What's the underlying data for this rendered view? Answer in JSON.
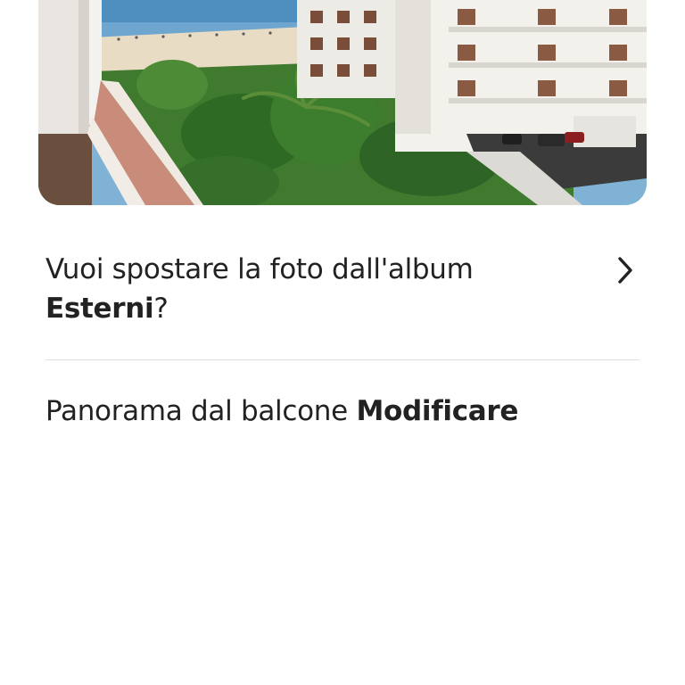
{
  "photo": {
    "image": "balcony-sea-view-photo"
  },
  "move_album": {
    "prompt_text": "Vuoi spostare la foto dall'album",
    "album_name": "Esterni",
    "question_mark": "?",
    "chevron_icon": "chevron-right-icon"
  },
  "caption": {
    "title": "Panorama dal balcone",
    "edit_label": "Modificare"
  },
  "colors": {
    "text": "#222222",
    "divider": "#dddddd",
    "background": "#ffffff"
  }
}
